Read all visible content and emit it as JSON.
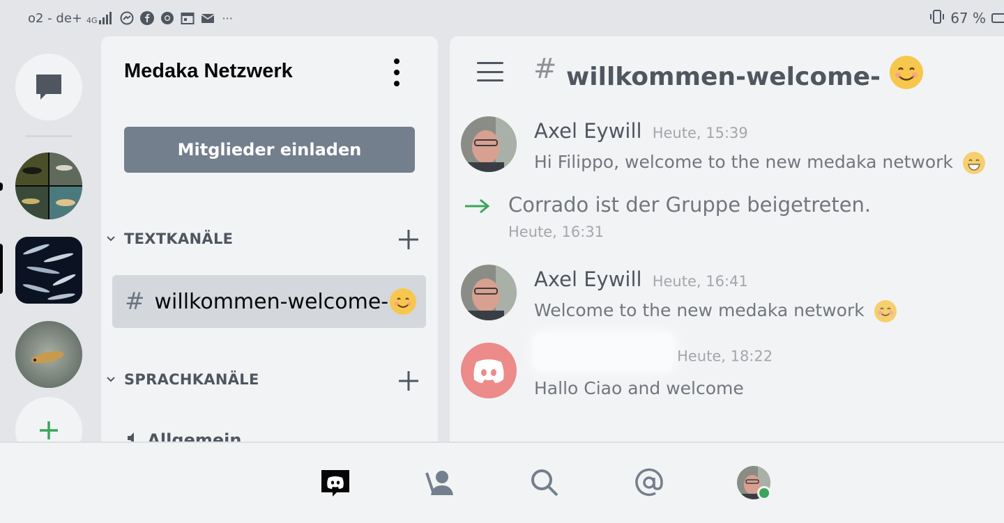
{
  "status_bar": {
    "carrier": "o2 - de+",
    "network": "4G",
    "battery": "67 %",
    "icons": [
      "messenger-icon",
      "facebook-icon",
      "chrome-icon",
      "calendar-icon",
      "mail-icon",
      "more-icon",
      "vibrate-icon",
      "battery-icon"
    ],
    "more_label": "···"
  },
  "rail": {
    "servers": [
      "medaka-server-1",
      "medaka-server-2",
      "medaka-server-3"
    ]
  },
  "channels": {
    "server_name": "Medaka Netzwerk",
    "invite_label": "Mitglieder einladen",
    "text_category": "TEXTKANÄLE",
    "voice_category": "SPRACHKANÄLE",
    "active_channel": "willkommen-welcome-",
    "hash": "#",
    "voice_channel_partial": "Allgemein"
  },
  "chat": {
    "title": "willkommen-welcome-",
    "hash": "#",
    "messages": [
      {
        "author": "Axel Eywill",
        "time": "Heute, 15:39",
        "text": "Hi Filippo, welcome to the new medaka network"
      },
      {
        "author": "Axel Eywill",
        "time": "Heute, 16:41",
        "text": "Welcome to the new medaka network"
      },
      {
        "author": "",
        "time": "Heute, 18:22",
        "text": "Hallo Ciao and welcome"
      }
    ],
    "join": {
      "text": "Corrado ist der Gruppe beigetreten.",
      "time": "Heute, 16:31"
    }
  },
  "colors": {
    "accent_green": "#3ba55c",
    "discord_red_avatar": "#ed8a8a",
    "invite_button": "#747f8d"
  },
  "bottom_nav": [
    "home-icon",
    "friends-icon",
    "search-icon",
    "mentions-icon",
    "profile-avatar"
  ]
}
